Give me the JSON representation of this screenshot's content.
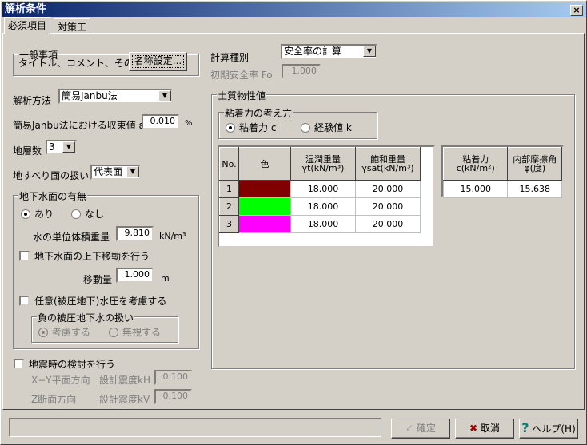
{
  "window": {
    "title": "解析条件",
    "close": "×"
  },
  "tabs": [
    {
      "label": "必須項目"
    },
    {
      "label": "対策工"
    }
  ],
  "general": {
    "legend": "一般事項",
    "label": "タイトル、コメント、その他:",
    "button": "名称設定..."
  },
  "method": {
    "label": "解析方法",
    "value": "簡易Janbu法"
  },
  "convergence": {
    "label": "簡易Janbu法における収束値 ε",
    "value": "0.010",
    "unit": "%"
  },
  "layers": {
    "label": "地層数",
    "value": "3"
  },
  "slip": {
    "label": "地すべり面の扱い",
    "value": "代表面"
  },
  "groundwater": {
    "legend": "地下水面の有無",
    "yes": "あり",
    "no": "なし",
    "selected": "あり",
    "unit_weight_label": "水の単位体積重量",
    "unit_weight": "9.810",
    "unit_weight_unit": "kN/m³",
    "move_check": "地下水面の上下移動を行う",
    "move_checked": false,
    "move_label": "移動量",
    "move_value": "1.000",
    "move_unit": "m",
    "pressure_check": "任意(被圧地下)水圧を考慮する",
    "pressure_checked": false,
    "negative": {
      "legend": "負の被圧地下水の扱い",
      "consider": "考慮する",
      "ignore": "無視する",
      "selected": "考慮する"
    }
  },
  "seismic": {
    "check": "地震時の検討を行う",
    "checked": false,
    "xy_label": "X−Y平面方向",
    "kh_label": "設計震度kH",
    "kh": "0.100",
    "z_label": "Z断面方向",
    "kv_label": "設計震度kV",
    "kv": "0.100"
  },
  "calc": {
    "label": "計算種別",
    "value": "安全率の計算",
    "fo_label": "初期安全率 Fo",
    "fo": "1.000"
  },
  "soil": {
    "legend": "土質物性値",
    "cohesion_mode": {
      "legend": "粘着力の考え方",
      "c": "粘着力 c",
      "k": "経験値 k",
      "selected": "粘着力 c"
    },
    "headers": {
      "no": "No.",
      "color": "色",
      "wet1": "湿潤重量",
      "wet2": "γt(kN/m³)",
      "sat1": "飽和重量",
      "sat2": "γsat(kN/m³)",
      "c1": "粘着力",
      "c2": "c(kN/m²)",
      "phi1": "内部摩擦角",
      "phi2": "φ(度)"
    },
    "rows": [
      {
        "no": "1",
        "color": "#800000",
        "wet": "18.000",
        "sat": "20.000"
      },
      {
        "no": "2",
        "color": "#00ff00",
        "wet": "18.000",
        "sat": "20.000"
      },
      {
        "no": "3",
        "color": "#ff00ff",
        "wet": "18.000",
        "sat": "20.000"
      }
    ],
    "strength": {
      "c": "15.000",
      "phi": "15.638"
    }
  },
  "buttons": {
    "ok": "確定",
    "cancel": "取消",
    "help": "ヘルプ(H)"
  }
}
